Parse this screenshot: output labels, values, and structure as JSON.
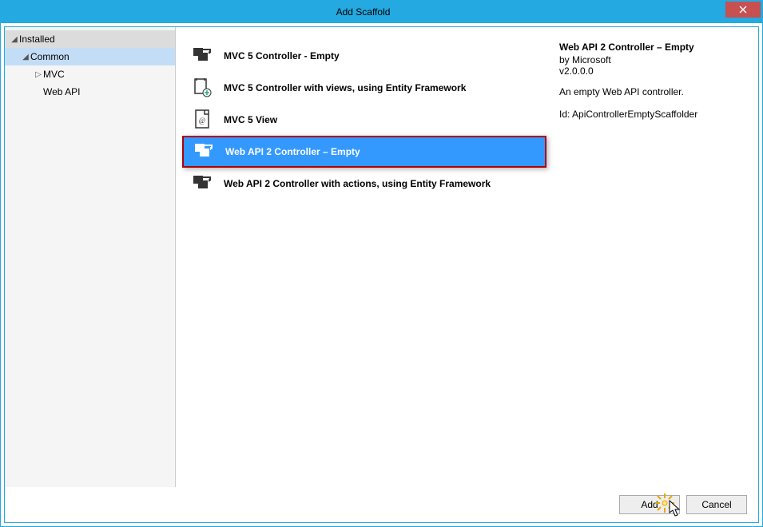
{
  "window": {
    "title": "Add Scaffold"
  },
  "sidebar": {
    "header": "Installed",
    "items": [
      {
        "label": "Common",
        "level": 1,
        "expandable": true,
        "selected": true
      },
      {
        "label": "MVC",
        "level": 2,
        "expandable": true,
        "selected": false
      },
      {
        "label": "Web API",
        "level": 2,
        "expandable": false,
        "selected": false
      }
    ]
  },
  "list": {
    "items": [
      {
        "label": "MVC 5 Controller - Empty",
        "icon": "controller",
        "selected": false
      },
      {
        "label": "MVC 5 Controller with views, using Entity Framework",
        "icon": "controller-plus",
        "selected": false
      },
      {
        "label": "MVC 5 View",
        "icon": "view",
        "selected": false
      },
      {
        "label": "Web API 2 Controller – Empty",
        "icon": "controller-white",
        "selected": true
      },
      {
        "label": "Web API 2 Controller with actions, using Entity Framework",
        "icon": "controller",
        "selected": false
      }
    ]
  },
  "details": {
    "title": "Web API 2 Controller – Empty",
    "by": "by Microsoft",
    "version": "v2.0.0.0",
    "description": "An empty Web API controller.",
    "id": "Id: ApiControllerEmptyScaffolder"
  },
  "footer": {
    "add": "Add",
    "cancel": "Cancel"
  }
}
